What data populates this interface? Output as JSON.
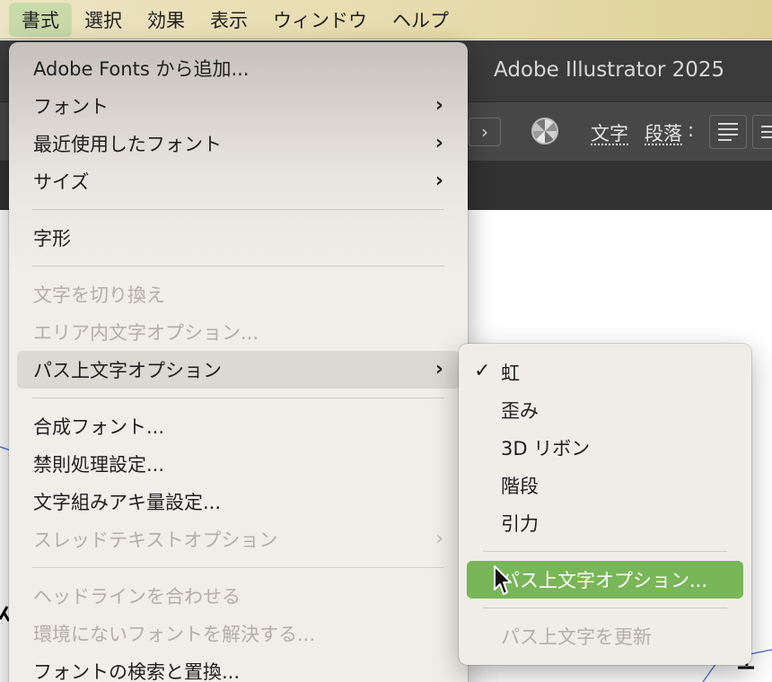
{
  "menubar": {
    "items": [
      {
        "label": "書式",
        "active": true
      },
      {
        "label": "選択"
      },
      {
        "label": "効果"
      },
      {
        "label": "表示"
      },
      {
        "label": "ウィンドウ"
      },
      {
        "label": "ヘルプ"
      }
    ]
  },
  "app": {
    "title": "Adobe Illustrator 2025",
    "control_bar": {
      "nav_glyph": "›",
      "recolor_icon": "recolor-artwork-icon",
      "character_label": "文字",
      "paragraph_label": "段落",
      "colon": ":"
    }
  },
  "type_menu": {
    "items": [
      {
        "label": "Adobe Fonts から追加...",
        "enabled": true
      },
      {
        "label": "フォント",
        "submenu": true,
        "enabled": true
      },
      {
        "label": "最近使用したフォント",
        "submenu": true,
        "enabled": true
      },
      {
        "label": "サイズ",
        "submenu": true,
        "enabled": true
      },
      {
        "separator": true
      },
      {
        "label": "字形",
        "enabled": true
      },
      {
        "separator": true
      },
      {
        "label": "文字を切り換え",
        "enabled": false
      },
      {
        "label": "エリア内文字オプション...",
        "enabled": false
      },
      {
        "label": "パス上文字オプション",
        "submenu": true,
        "enabled": true,
        "highlighted": true
      },
      {
        "separator": true
      },
      {
        "label": "合成フォント...",
        "enabled": true
      },
      {
        "label": "禁則処理設定...",
        "enabled": true
      },
      {
        "label": "文字組みアキ量設定...",
        "enabled": true
      },
      {
        "label": "スレッドテキストオプション",
        "submenu": true,
        "enabled": false
      },
      {
        "separator": true
      },
      {
        "label": "ヘッドラインを合わせる",
        "enabled": false
      },
      {
        "label": "環境にないフォントを解決する...",
        "enabled": false
      },
      {
        "label": "フォントの検索と置換...",
        "enabled": true
      }
    ],
    "chevron_glyph": "›"
  },
  "path_type_submenu": {
    "items": [
      {
        "label": "虹",
        "checked": true,
        "enabled": true
      },
      {
        "label": "歪み",
        "enabled": true
      },
      {
        "label": "3D リボン",
        "enabled": true
      },
      {
        "label": "階段",
        "enabled": true
      },
      {
        "label": "引力",
        "enabled": true
      },
      {
        "separator": true
      },
      {
        "label": "パス上文字オプション...",
        "enabled": true,
        "selected": true
      },
      {
        "separator": true
      },
      {
        "label": "パス上文字を更新",
        "enabled": false
      }
    ],
    "check_glyph": "✓"
  },
  "colors": {
    "highlight_green": "#79b657",
    "menu_background": "#f1eeea",
    "disabled_text": "#b3aeaa",
    "app_dark": "#3b3b3b"
  }
}
